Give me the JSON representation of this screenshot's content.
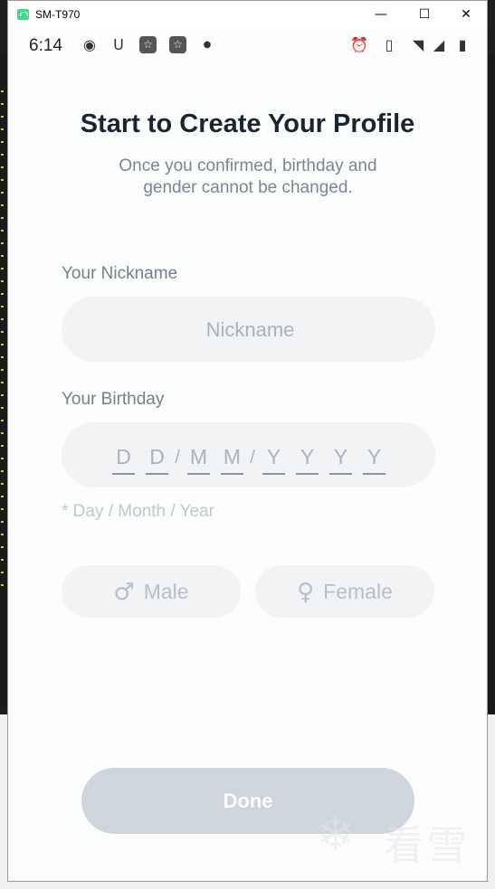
{
  "window": {
    "title": "SM-T970",
    "controls": {
      "minimize": "—",
      "maximize": "☐",
      "close": "✕"
    }
  },
  "statusbar": {
    "time": "6:14",
    "left_icons": [
      "record-icon",
      "magnet-icon",
      "star-box-icon",
      "star-box-icon",
      "dot-icon"
    ],
    "right_icons": [
      "alarm-icon",
      "vibrate-icon",
      "wifi-icon",
      "no-signal-icon",
      "battery-icon"
    ]
  },
  "profile": {
    "title": "Start to Create Your Profile",
    "subtitle": "Once you confirmed, birthday and gender cannot be changed.",
    "nickname": {
      "label": "Your Nickname",
      "placeholder": "Nickname",
      "value": ""
    },
    "birthday": {
      "label": "Your Birthday",
      "slots": [
        "D",
        "D",
        "M",
        "M",
        "Y",
        "Y",
        "Y",
        "Y"
      ],
      "separator": "/",
      "hint": "* Day / Month / Year"
    },
    "gender": {
      "male_label": "Male",
      "female_label": "Female",
      "male_icon": "male-symbol-icon",
      "female_icon": "female-symbol-icon",
      "selected": null
    },
    "done_label": "Done"
  },
  "watermark": {
    "text": "看雪"
  },
  "colors": {
    "heading": "#1b2431",
    "muted": "#7b8592",
    "field_bg": "#f1f3f5",
    "button_disabled": "#cfd5dd"
  }
}
